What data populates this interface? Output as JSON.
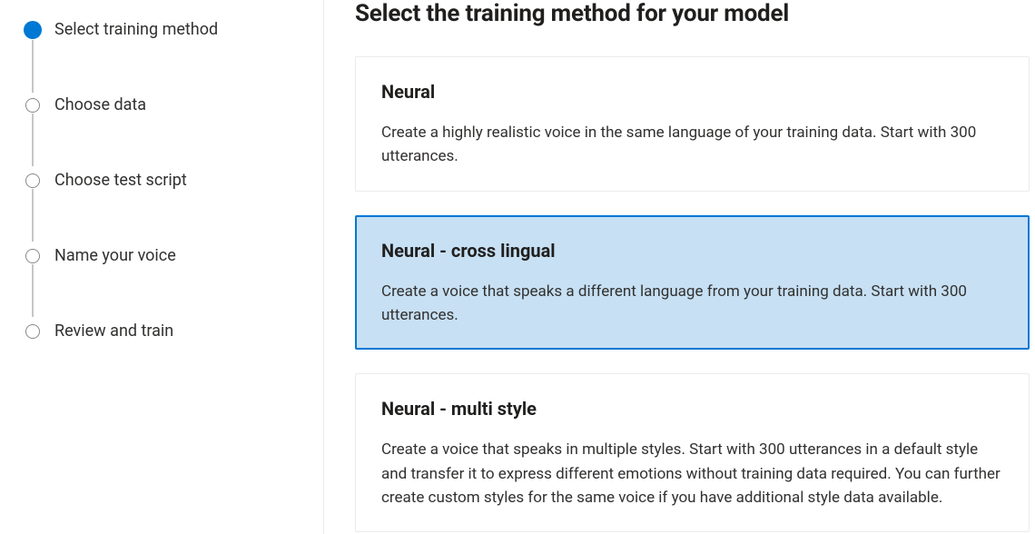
{
  "sidebar": {
    "steps": [
      {
        "label": "Select training method",
        "active": true
      },
      {
        "label": "Choose data",
        "active": false
      },
      {
        "label": "Choose test script",
        "active": false
      },
      {
        "label": "Name your voice",
        "active": false
      },
      {
        "label": "Review and train",
        "active": false
      }
    ]
  },
  "main": {
    "title": "Select the training method for your model",
    "options": [
      {
        "title": "Neural",
        "description": "Create a highly realistic voice in the same language of your training data. Start with 300 utterances.",
        "selected": false
      },
      {
        "title": "Neural - cross lingual",
        "description": "Create a voice that speaks a different language from your training data. Start with 300 utterances.",
        "selected": true
      },
      {
        "title": "Neural - multi style",
        "description": "Create a voice that speaks in multiple styles. Start with 300 utterances in a default style and transfer it to express different emotions without training data required. You can further create custom styles for the same voice if you have additional style data available.",
        "selected": false
      }
    ]
  }
}
